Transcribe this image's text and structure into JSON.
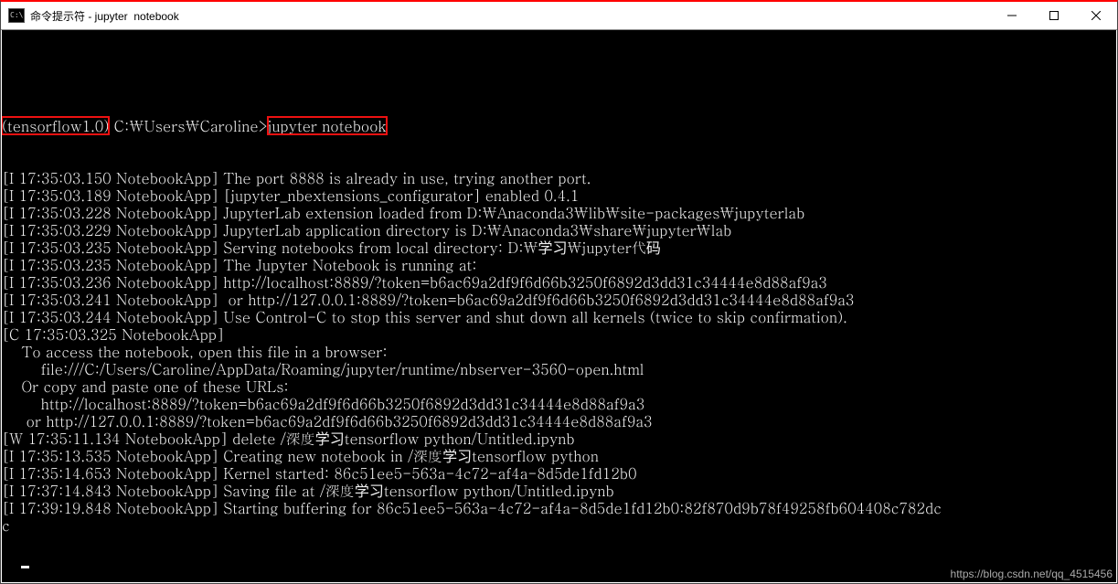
{
  "window": {
    "title": "命令提示符 - jupyter  notebook"
  },
  "prompt": {
    "env": "(tensorflow1.0)",
    "path": " C:\\Users\\Caroline>",
    "cmd": "jupyter notebook"
  },
  "lines": [
    "[I 17:35:03.150 NotebookApp] The port 8888 is already in use, trying another port.",
    "[I 17:35:03.189 NotebookApp] [jupyter_nbextensions_configurator] enabled 0.4.1",
    "[I 17:35:03.228 NotebookApp] JupyterLab extension loaded from D:\\Anaconda3\\lib\\site-packages\\jupyterlab",
    "[I 17:35:03.229 NotebookApp] JupyterLab application directory is D:\\Anaconda3\\share\\jupyter\\lab",
    "[I 17:35:03.235 NotebookApp] Serving notebooks from local directory: D:\\学习\\jupyter代码",
    "[I 17:35:03.235 NotebookApp] The Jupyter Notebook is running at:",
    "[I 17:35:03.236 NotebookApp] http://localhost:8889/?token=b6ac69a2df9f6d66b3250f6892d3dd31c34444e8d88af9a3",
    "[I 17:35:03.241 NotebookApp]  or http://127.0.0.1:8889/?token=b6ac69a2df9f6d66b3250f6892d3dd31c34444e8d88af9a3",
    "[I 17:35:03.244 NotebookApp] Use Control-C to stop this server and shut down all kernels (twice to skip confirmation).",
    "[C 17:35:03.325 NotebookApp]",
    "",
    "    To access the notebook, open this file in a browser:",
    "        file:///C:/Users/Caroline/AppData/Roaming/jupyter/runtime/nbserver-3560-open.html",
    "    Or copy and paste one of these URLs:",
    "        http://localhost:8889/?token=b6ac69a2df9f6d66b3250f6892d3dd31c34444e8d88af9a3",
    "     or http://127.0.0.1:8889/?token=b6ac69a2df9f6d66b3250f6892d3dd31c34444e8d88af9a3",
    "[W 17:35:11.134 NotebookApp] delete /深度学习tensorflow python/Untitled.ipynb",
    "[I 17:35:13.535 NotebookApp] Creating new notebook in /深度学习tensorflow python",
    "[I 17:35:14.653 NotebookApp] Kernel started: 86c51ee5-563a-4c72-af4a-8d5de1fd12b0",
    "[I 17:37:14.843 NotebookApp] Saving file at /深度学习tensorflow python/Untitled.ipynb",
    "[I 17:39:19.848 NotebookApp] Starting buffering for 86c51ee5-563a-4c72-af4a-8d5de1fd12b0:82f870d9b78f49258fb604408c782dc",
    "c"
  ],
  "watermark": "https://blog.csdn.net/qq_4515456"
}
